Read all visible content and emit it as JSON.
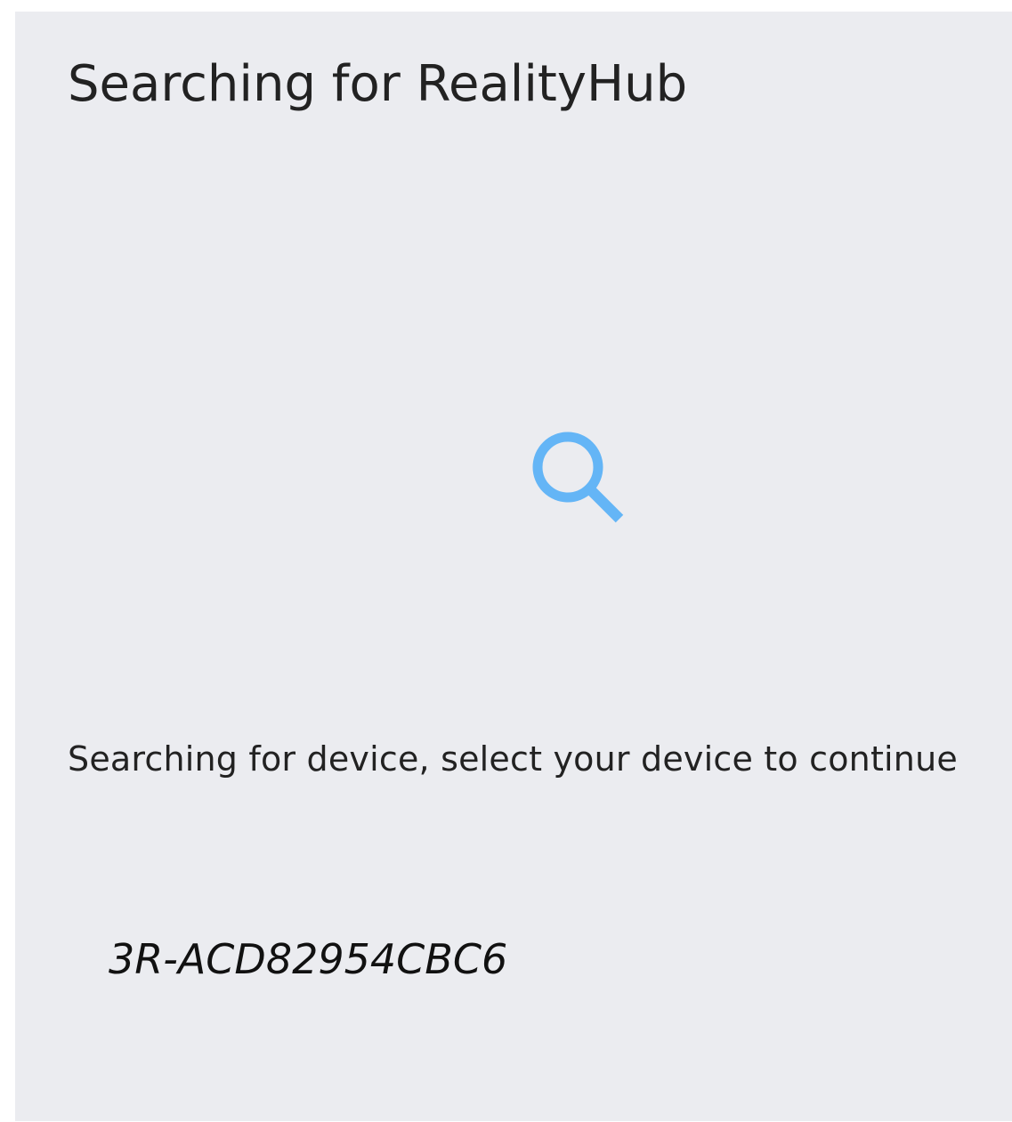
{
  "page": {
    "title": "Searching for RealityHub",
    "status_text": "Searching for device, select your device to continue"
  },
  "icon": {
    "name": "search-icon",
    "color": "#64b5f6"
  },
  "devices": [
    {
      "name": "3R-ACD82954CBC6"
    }
  ],
  "colors": {
    "background": "#ebecf0",
    "text": "#222222"
  }
}
